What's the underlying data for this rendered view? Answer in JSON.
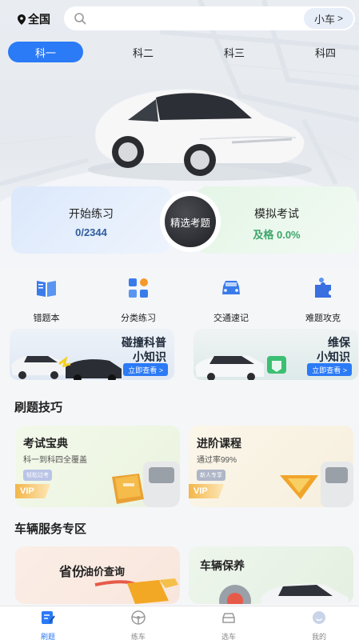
{
  "header": {
    "location": "全国",
    "search_placeholder": "",
    "vehicle_type": "小车"
  },
  "subjects": [
    {
      "label": "科一",
      "active": true
    },
    {
      "label": "科二",
      "active": false
    },
    {
      "label": "科三",
      "active": false
    },
    {
      "label": "科四",
      "active": false
    }
  ],
  "practice": {
    "start_label": "开始练习",
    "start_progress": "0/2344",
    "center_label": "精选考题",
    "exam_label": "模拟考试",
    "exam_result": "及格 0.0%"
  },
  "quick_icons": [
    {
      "label": "错题本",
      "icon": "book-icon"
    },
    {
      "label": "分类练习",
      "icon": "category-grid-icon"
    },
    {
      "label": "交通速记",
      "icon": "car-front-icon"
    },
    {
      "label": "难题攻克",
      "icon": "puzzle-icon"
    }
  ],
  "banners": [
    {
      "title1": "碰撞科普",
      "title2": "小知识",
      "button": "立即查看 >"
    },
    {
      "title1": "维保",
      "title2": "小知识",
      "button": "立即查看 >"
    }
  ],
  "tips_section": {
    "title": "刷题技巧",
    "cards": [
      {
        "title": "考试宝典",
        "subtitle": "科一到科四全覆盖",
        "tag": "轻松过考",
        "badge": "VIP"
      },
      {
        "title": "进阶课程",
        "subtitle": "通过率99%",
        "tag": "新人专享",
        "badge": "VIP"
      }
    ]
  },
  "service_section": {
    "title": "车辆服务专区",
    "cards": [
      {
        "title": "省份",
        "subtitle": "油价查询"
      },
      {
        "title": "车辆保养",
        "subtitle": ""
      }
    ]
  },
  "tabs": [
    {
      "label": "刷题",
      "icon": "edit-icon",
      "active": true
    },
    {
      "label": "练车",
      "icon": "steering-wheel-icon",
      "active": false
    },
    {
      "label": "选车",
      "icon": "car-icon",
      "active": false
    },
    {
      "label": "我的",
      "icon": "face-icon",
      "active": false
    }
  ],
  "colors": {
    "accent": "#2b7af6",
    "pass_green": "#3ea56b",
    "progress_blue": "#2f5d9c"
  }
}
